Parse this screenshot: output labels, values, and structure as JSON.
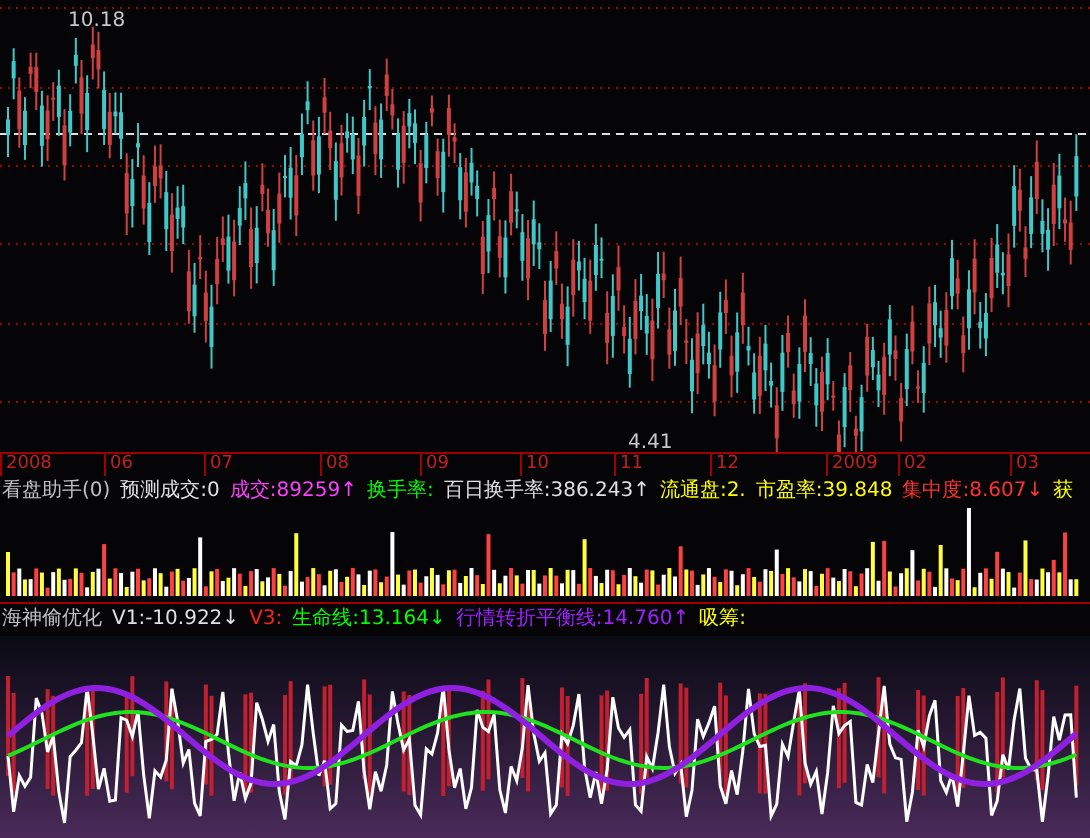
{
  "price_panel": {
    "high_label": "10.18",
    "low_label": "4.41"
  },
  "date_axis": [
    "2008",
    "06",
    "07",
    "08",
    "09",
    "10",
    "11",
    "12",
    "2009",
    "02",
    "03"
  ],
  "volume_header": [
    {
      "text": "看盘助手(0)",
      "color": "#c0c0c0"
    },
    {
      "text": "预测成交:0",
      "color": "#e0e0e0"
    },
    {
      "text": "成交:89259↑",
      "color": "#ff40ff"
    },
    {
      "text": "换手率:",
      "color": "#00ff00"
    },
    {
      "text": "百日换手率:386.243↑",
      "color": "#e0e0e0"
    },
    {
      "text": "流通盘:2.",
      "color": "#ffff00"
    },
    {
      "text": "市盈率:39.848",
      "color": "#ffff00"
    },
    {
      "text": "集中度:8.607↓",
      "color": "#ff3030"
    },
    {
      "text": "获",
      "color": "#ffff00"
    }
  ],
  "indicator_header": [
    {
      "text": "海神偷优化",
      "color": "#c0c0c0"
    },
    {
      "text": "V1:-10.922↓",
      "color": "#e0e0e0"
    },
    {
      "text": "V3:",
      "color": "#ff2020"
    },
    {
      "text": "生命线:13.164↓",
      "color": "#00ff00"
    },
    {
      "text": "行情转折平衡线:14.760↑",
      "color": "#a020ff"
    },
    {
      "text": "吸筹:",
      "color": "#ffff00"
    }
  ]
}
